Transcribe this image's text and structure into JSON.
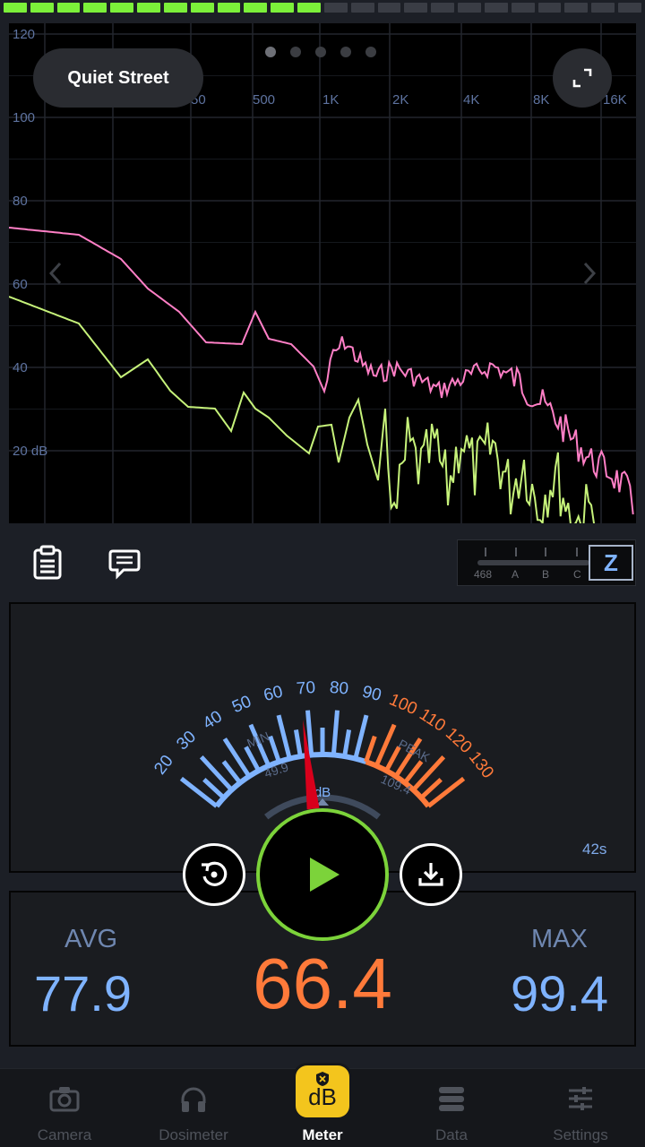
{
  "preset": {
    "name": "Quiet Street"
  },
  "spectrum": {
    "y_ticks": [
      "120",
      "100",
      "80",
      "60",
      "40",
      "20 dB"
    ],
    "x_ticks": [
      "50",
      "500",
      "1K",
      "2K",
      "4K",
      "8K",
      "16K"
    ],
    "page_count": 5,
    "active_page": 1,
    "series_colors": {
      "max": "#ff7fc6",
      "current": "#c6f27a"
    }
  },
  "weighting": {
    "labels": [
      "468",
      "A",
      "B",
      "C"
    ],
    "selected": "Z"
  },
  "meter": {
    "scale_blue": [
      "20",
      "30",
      "40",
      "50",
      "60",
      "70",
      "80",
      "90"
    ],
    "scale_orange": [
      "100",
      "110",
      "120",
      "130"
    ],
    "min_label": "MIN",
    "min_value": "49.9",
    "peak_label": "PEAK",
    "peak_value": "109.4",
    "unit": "dB",
    "elapsed": "42s",
    "needle_value": 68
  },
  "stats": {
    "avg_label": "AVG",
    "avg_value": "77.9",
    "current_value": "66.4",
    "max_label": "MAX",
    "max_value": "99.4"
  },
  "tabs": [
    {
      "label": "Camera",
      "icon": "camera-icon"
    },
    {
      "label": "Dosimeter",
      "icon": "headphones-icon"
    },
    {
      "label": "Meter",
      "icon": "db-badge-icon",
      "active": true
    },
    {
      "label": "Data",
      "icon": "database-icon"
    },
    {
      "label": "Settings",
      "icon": "sliders-icon"
    }
  ],
  "colors": {
    "accent_green": "#7cd33a",
    "accent_orange": "#ff7a3a",
    "accent_blue": "#7fb3ff",
    "badge_yellow": "#f3c51d"
  }
}
